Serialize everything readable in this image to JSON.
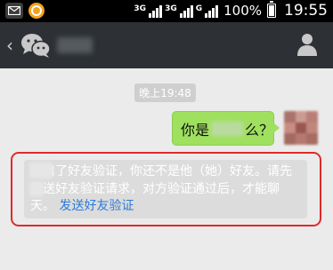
{
  "status_bar": {
    "network_1": "3G",
    "network_2": "3G",
    "network_3": "G",
    "battery": "100%",
    "time": "19:55"
  },
  "title_bar": {
    "back_icon": "chevron-left-icon",
    "logo_icon": "wechat-logo-icon",
    "profile_icon": "person-icon"
  },
  "chat": {
    "timestamp": "晚上19:48",
    "outgoing_message": {
      "prefix": "你是",
      "suffix": "么？"
    },
    "system_notice": {
      "text": "开启了好友验证，你还不是他（她）好友。请先发送好友验证请求，对方验证通过后，才能聊天。",
      "link": "发送好友验证"
    }
  },
  "colors": {
    "status_bar": "#000000",
    "title_bar": "#2d3034",
    "outgoing_bubble": "#9fe05f",
    "notice_bg": "#dcdcdc",
    "link": "#2d7bd8",
    "highlight": "#e02a2a"
  }
}
